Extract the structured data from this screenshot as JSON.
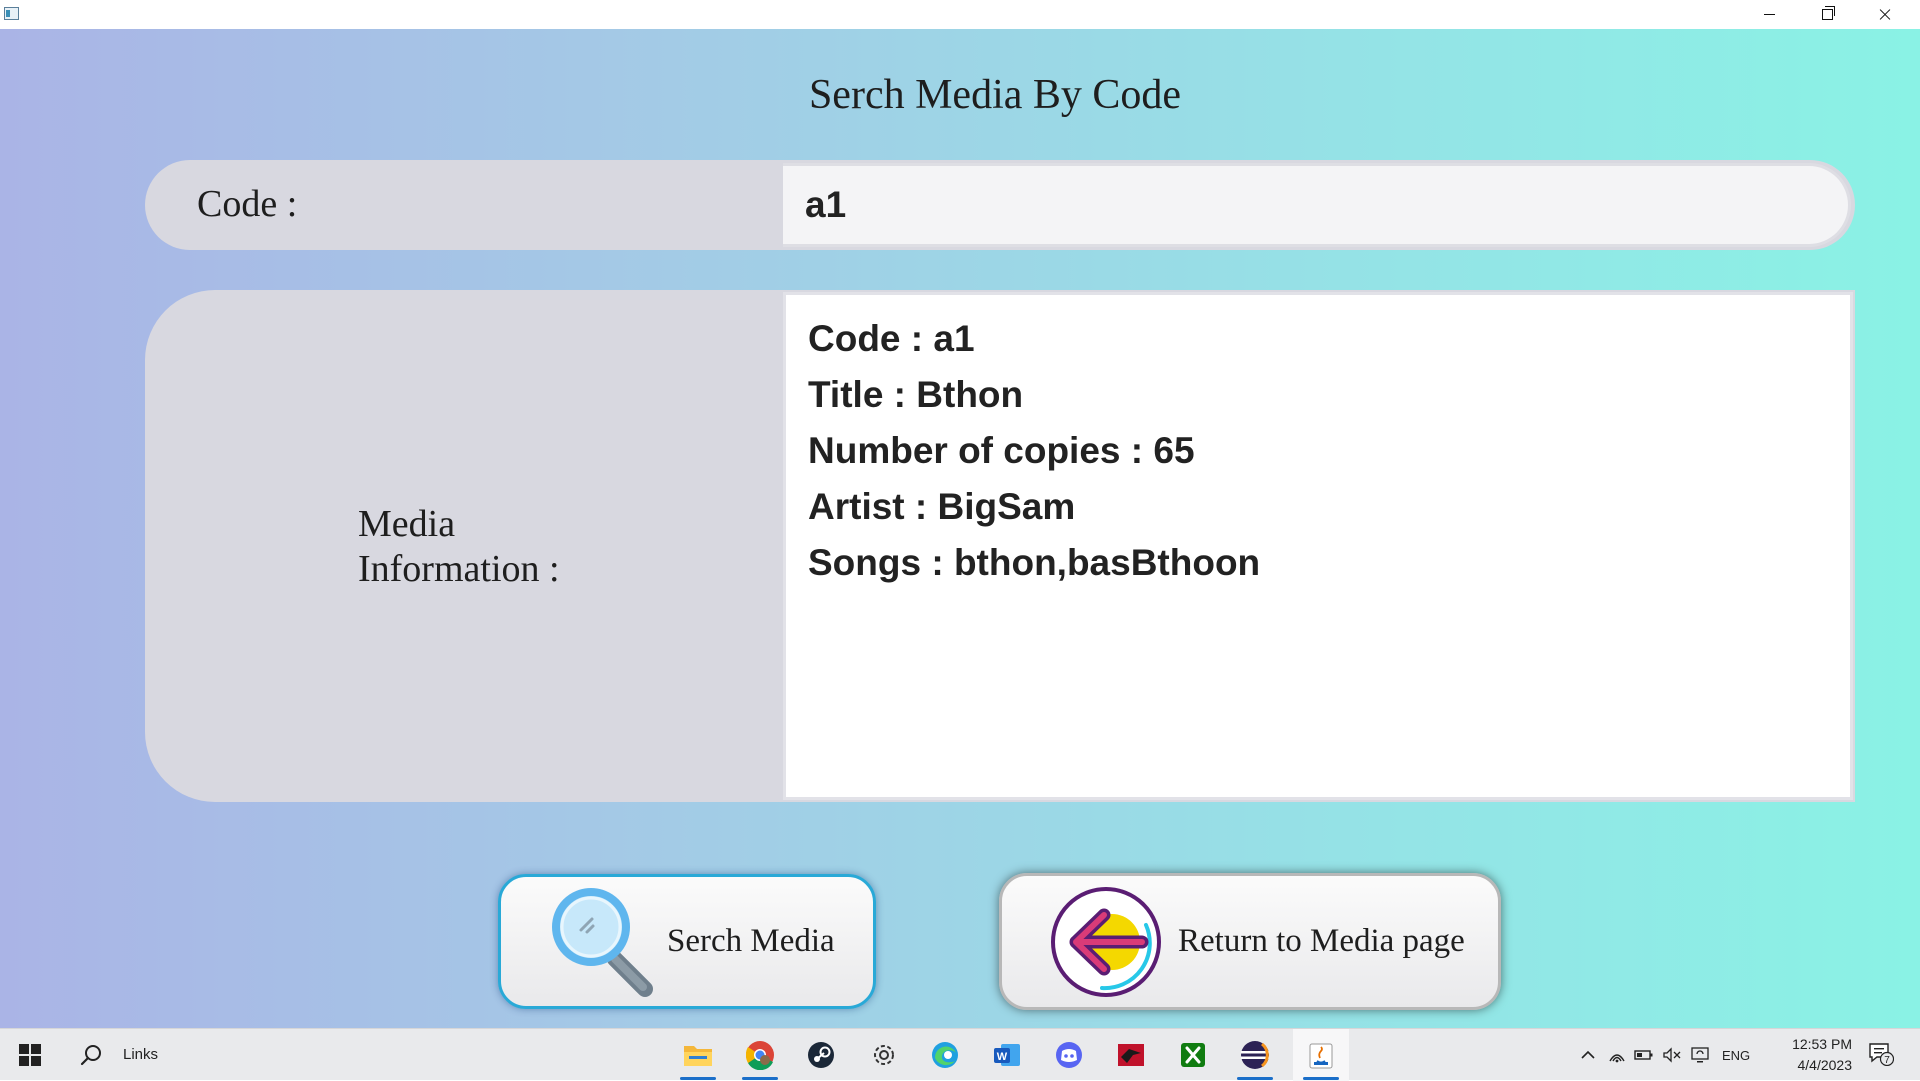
{
  "window": {
    "minimize_icon": "minimize-icon",
    "maximize_icon": "restore-icon",
    "close_icon": "close-icon"
  },
  "page": {
    "title": "Serch Media By Code"
  },
  "code_field": {
    "label": "Code :",
    "value": "a1"
  },
  "media_info": {
    "label_line1": "Media",
    "label_line2": "Information :",
    "lines": [
      "Code : a1",
      "Title : Bthon",
      "Number of copies : 65",
      "Artist : BigSam",
      "Songs : bthon,basBthoon"
    ]
  },
  "buttons": {
    "search_label": "Serch Media",
    "return_label": "Return to Media page"
  },
  "taskbar": {
    "search_text": "Links",
    "apps": [
      "file-explorer-icon",
      "chrome-icon",
      "steam-icon",
      "settings-icon",
      "edge-icon",
      "word-icon",
      "discord-icon",
      "red-app-icon",
      "xbox-icon",
      "eclipse-icon",
      "java-icon"
    ],
    "language": "ENG",
    "time": "12:53 PM",
    "date": "4/4/2023",
    "notification_count": "7"
  }
}
